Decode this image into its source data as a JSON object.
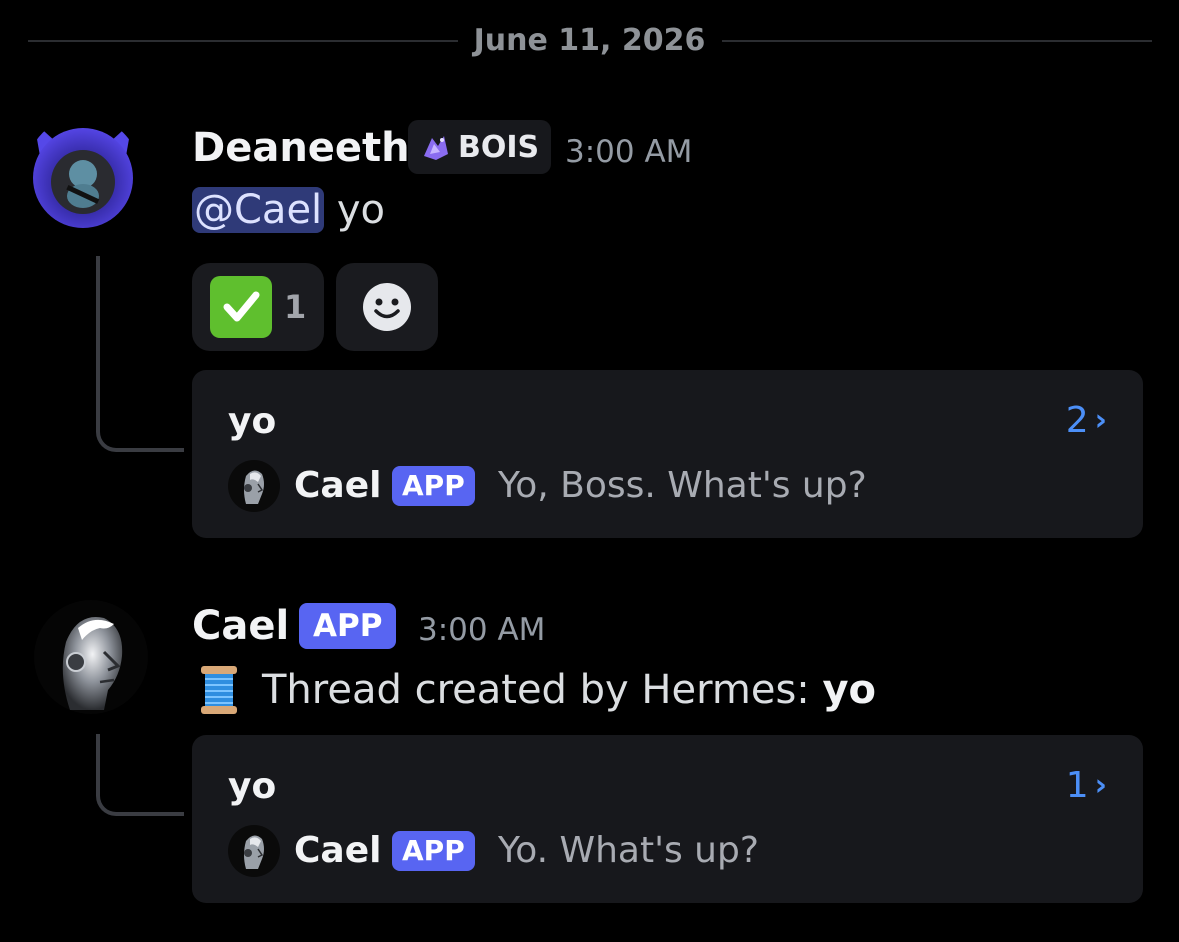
{
  "date_divider": "June 11, 2026",
  "messages": [
    {
      "author": "Deaneeth",
      "role_tag": "BOIS",
      "time": "3:00 AM",
      "mention": "@Cael",
      "text": " yo",
      "reactions": [
        {
          "emoji": "check-mark-button",
          "count": "1"
        },
        {
          "emoji": "add-reaction"
        }
      ],
      "thread": {
        "title": "yo",
        "count": "2",
        "chevron": "›",
        "author": "Cael",
        "badge": "APP",
        "preview": "Yo, Boss. What's up?"
      }
    },
    {
      "author": "Cael",
      "badge": "APP",
      "time": "3:00 AM",
      "text_prefix": "Thread created by Hermes: ",
      "text_bold": "yo",
      "thread": {
        "title": "yo",
        "count": "1",
        "chevron": "›",
        "author": "Cael",
        "badge": "APP",
        "preview": "Yo. What's up?"
      }
    }
  ],
  "colors": {
    "background": "#000000",
    "app_badge": "#5865f2",
    "mention_bg": "#2f3a78",
    "thread_count": "#4c8ff7",
    "card": "#17181c"
  }
}
